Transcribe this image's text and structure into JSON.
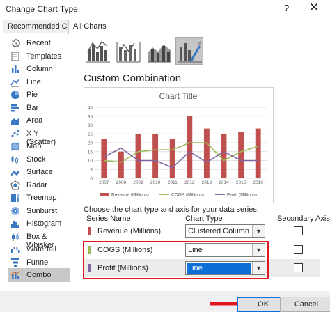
{
  "window": {
    "title": "Change Chart Type",
    "help_glyph": "?",
    "close_glyph": "✕"
  },
  "tabs": [
    {
      "label": "Recommended Charts",
      "active": false
    },
    {
      "label": "All Charts",
      "active": true
    }
  ],
  "sidebar": {
    "items": [
      {
        "label": "Recent",
        "icon": "recent-icon"
      },
      {
        "label": "Templates",
        "icon": "templates-icon"
      },
      {
        "label": "Column",
        "icon": "column-chart-icon"
      },
      {
        "label": "Line",
        "icon": "line-chart-icon"
      },
      {
        "label": "Pie",
        "icon": "pie-chart-icon"
      },
      {
        "label": "Bar",
        "icon": "bar-chart-icon"
      },
      {
        "label": "Area",
        "icon": "area-chart-icon"
      },
      {
        "label": "X Y (Scatter)",
        "icon": "scatter-chart-icon"
      },
      {
        "label": "Map",
        "icon": "map-chart-icon"
      },
      {
        "label": "Stock",
        "icon": "stock-chart-icon"
      },
      {
        "label": "Surface",
        "icon": "surface-chart-icon"
      },
      {
        "label": "Radar",
        "icon": "radar-chart-icon"
      },
      {
        "label": "Treemap",
        "icon": "treemap-chart-icon"
      },
      {
        "label": "Sunburst",
        "icon": "sunburst-chart-icon"
      },
      {
        "label": "Histogram",
        "icon": "histogram-chart-icon"
      },
      {
        "label": "Box & Whisker",
        "icon": "box-whisker-chart-icon"
      },
      {
        "label": "Waterfall",
        "icon": "waterfall-chart-icon"
      },
      {
        "label": "Funnel",
        "icon": "funnel-chart-icon"
      },
      {
        "label": "Combo",
        "icon": "combo-chart-icon",
        "selected": true
      }
    ]
  },
  "combo_variants": [
    {
      "icon": "clustered-column-line-icon",
      "selected": false
    },
    {
      "icon": "clustered-column-line-secondary-icon",
      "selected": false
    },
    {
      "icon": "stacked-area-column-icon",
      "selected": false
    },
    {
      "icon": "custom-combination-icon",
      "selected": true
    }
  ],
  "section_title": "Custom Combination",
  "chart_data": {
    "type": "bar",
    "title": "Chart Title",
    "categories": [
      "2007",
      "2008",
      "2009",
      "2010",
      "2011",
      "2012",
      "2013",
      "2014",
      "2015",
      "2016"
    ],
    "ylim": [
      0,
      40
    ],
    "yticks": [
      "0",
      "5",
      "10",
      "15",
      "20",
      "25",
      "30",
      "35",
      "40"
    ],
    "grid": true,
    "legend_position": "bottom",
    "series": [
      {
        "name": "Revenue (Millions)",
        "kind": "column",
        "color": "#c0504d",
        "values": [
          22,
          15,
          25,
          25,
          22,
          35,
          28,
          25,
          26,
          28
        ]
      },
      {
        "name": "COGS (Millions)",
        "kind": "line",
        "color": "#9bbb59",
        "values": [
          10,
          9,
          15,
          16,
          16,
          20,
          20,
          10,
          15,
          18
        ]
      },
      {
        "name": "Profit (Millions)",
        "kind": "line",
        "color": "#8064a2",
        "values": [
          12,
          17,
          10,
          10,
          6,
          15,
          9,
          15,
          10,
          10
        ]
      }
    ]
  },
  "series_heading": "Choose the chart type and axis for your data series:",
  "table": {
    "headers": {
      "name": "Series Name",
      "type": "Chart Type",
      "axis": "Secondary Axis"
    },
    "rows": [
      {
        "name": "Revenue (Millions)",
        "color": "#c0504d",
        "type": "Clustered Column",
        "secondary": false
      },
      {
        "name": "COGS (Millions)",
        "color": "#9bbb59",
        "type": "Line",
        "secondary": false
      },
      {
        "name": "Profit (Millions)",
        "color": "#8064a2",
        "type": "Line",
        "secondary": false,
        "highlighted": true
      }
    ]
  },
  "buttons": {
    "ok": "OK",
    "cancel": "Cancel"
  },
  "colors": {
    "accent": "#0b6fd6",
    "annotation_red": "#e0191e"
  }
}
